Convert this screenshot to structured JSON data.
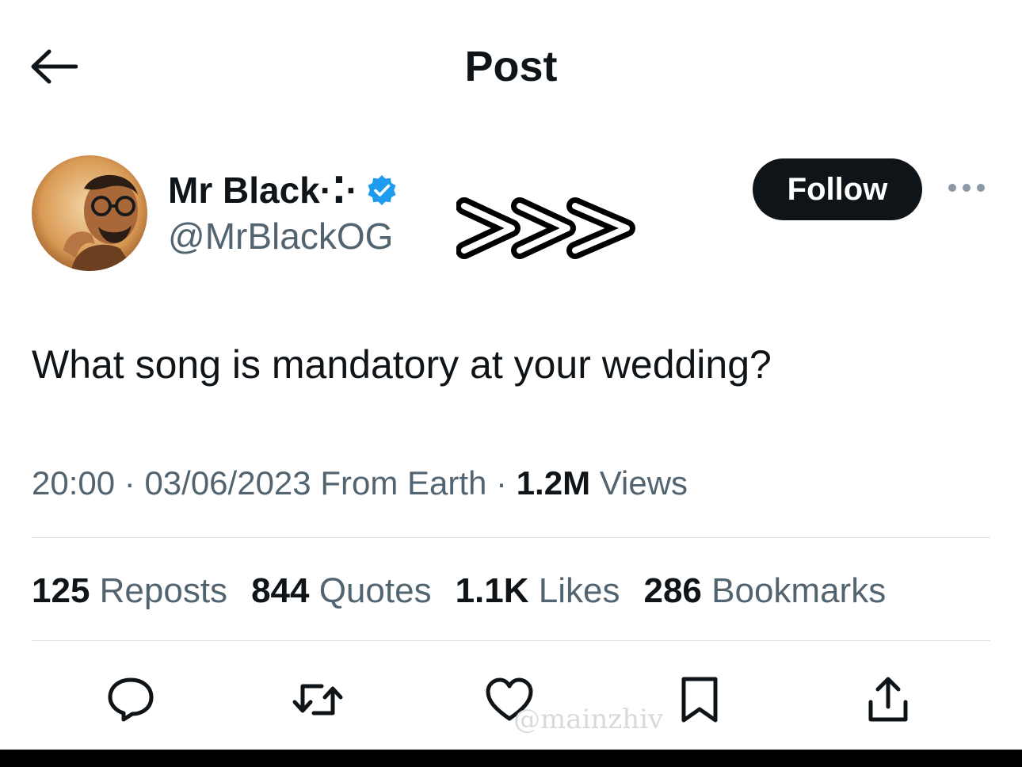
{
  "header": {
    "title": "Post",
    "back_icon": "arrow-left-icon"
  },
  "author": {
    "display_name": "Mr Black·⁚·",
    "handle": "@MrBlackOG",
    "verified_icon": "verified-badge-icon",
    "verified_color": "#1d9bf0",
    "follow_label": "Follow",
    "more_icon": "more-dots-icon",
    "overlay_icon": "triple-chevron-right-icon"
  },
  "post": {
    "text": "What song is mandatory at your wedding?"
  },
  "meta": {
    "time": "20:00",
    "sep1": " · ",
    "date": "03/06/2023",
    "source": " From Earth",
    "sep2": " · ",
    "views_count": "1.2M",
    "views_label": " Views"
  },
  "stats": [
    {
      "count": "125",
      "label": " Reposts"
    },
    {
      "count": "844",
      "label": " Quotes"
    },
    {
      "count": "1.1K",
      "label": " Likes"
    },
    {
      "count": "286",
      "label": " Bookmarks"
    }
  ],
  "actions": {
    "reply_icon": "reply-bubble-icon",
    "repost_icon": "repost-icon",
    "like_icon": "heart-icon",
    "bookmark_icon": "bookmark-icon",
    "share_icon": "share-icon"
  },
  "watermark": "@mainzhiv",
  "colors": {
    "text": "#0f1419",
    "secondary": "#536471",
    "divider": "#dfe3e6",
    "follow_bg": "#0f1419"
  }
}
